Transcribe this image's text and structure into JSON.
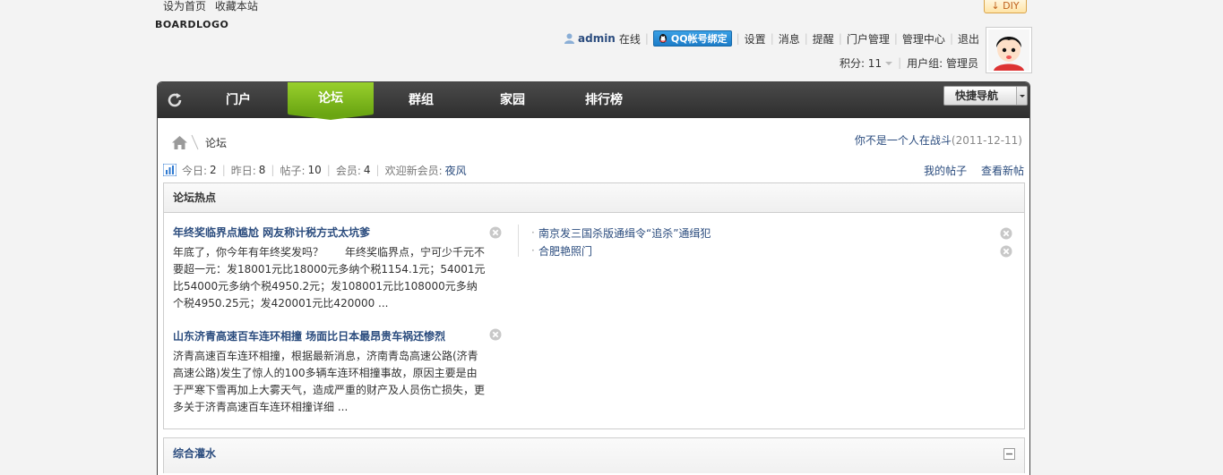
{
  "top": {
    "links": [
      "设为首页",
      "收藏本站"
    ],
    "diy_label": "DIY",
    "logo_text": "BOARDLOGO"
  },
  "user": {
    "name": "admin",
    "status": "在线",
    "qq_bind_label": "QQ帐号绑定",
    "menu": [
      "设置",
      "消息",
      "提醒",
      "门户管理",
      "管理中心",
      "退出"
    ],
    "points_label": "积分: 11",
    "group_label": "用户组: 管理员"
  },
  "nav": {
    "items": [
      "门户",
      "论坛",
      "群组",
      "家园",
      "排行榜"
    ],
    "active_index": 1,
    "quicknav_label": "快捷导航"
  },
  "breadcrumb": {
    "current": "论坛"
  },
  "announcement": {
    "text": "你不是一个人在战斗",
    "date": "(2011-12-11)"
  },
  "stats": {
    "today_label": "今日:",
    "today": "2",
    "yesterday_label": "昨日:",
    "yesterday": "8",
    "posts_label": "帖子:",
    "posts": "10",
    "members_label": "会员:",
    "members": "4",
    "newest_label": "欢迎新会员:",
    "newest": "夜风",
    "my_posts": "我的帖子",
    "new_posts": "查看新帖"
  },
  "hot": {
    "title": "论坛热点",
    "items": [
      {
        "title": "年终奖临界点尴尬 网友称计税方式太坑爹",
        "text": "年底了，你今年有年终奖发吗？　　年终奖临界点，宁可少千元不要超一元：发18001元比18000元多纳个税1154.1元；54001元比54000元多纳个税4950.2元；发108001元比108000元多纳个税4950.25元；发420001元比420000 ..."
      },
      {
        "title": "山东济青高速百车连环相撞 场面比日本最昂贵车祸还惨烈",
        "text": "济青高速百车连环相撞，根据最新消息，济南青岛高速公路(济青高速公路)发生了惊人的100多辆车连环相撞事故，原因主要是由于严寒下雪再加上大雾天气，造成严重的财产及人员伤亡损失，更多关于济青高速百车连环相撞详细 ..."
      }
    ],
    "links": [
      "南京发三国杀版通缉令“追杀”通缉犯",
      "合肥艳照门"
    ]
  },
  "section2": {
    "title": "综合灌水"
  },
  "colors": {
    "link": "#2b4c7e",
    "nav_bg": "#333333",
    "nav_active": "#7cb91c"
  }
}
